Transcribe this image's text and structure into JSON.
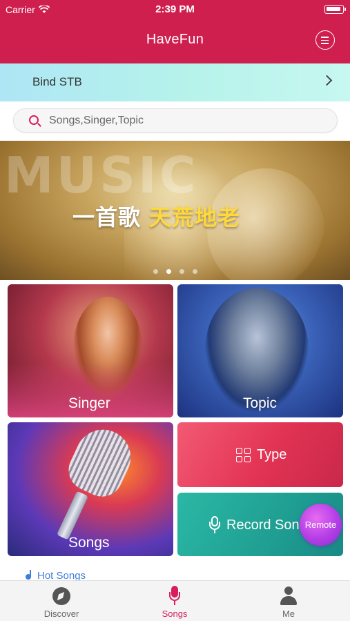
{
  "status_bar": {
    "carrier": "Carrier",
    "time": "2:39 PM"
  },
  "header": {
    "title": "HaveFun",
    "menu_icon": "menu-list-icon",
    "background": "#cf1f4f"
  },
  "bind_bar": {
    "label": "Bind STB",
    "icon": "chevron-right-icon"
  },
  "search": {
    "placeholder": "Songs,Singer,Topic",
    "value": "",
    "icon": "search-icon",
    "accent": "#d81e5b"
  },
  "banner": {
    "background_word": "MUSIC",
    "tagline_white": "一首歌",
    "tagline_yellow": "天荒地老",
    "page_count": 4,
    "active_page": 2
  },
  "tiles": {
    "singer": "Singer",
    "topic": "Topic",
    "songs": "Songs",
    "type": "Type",
    "record": "Record Songs",
    "remote": "Remote"
  },
  "section_peek": {
    "label": "Hot Songs"
  },
  "tabbar": {
    "active_color": "#d81e5b",
    "items": [
      {
        "label": "Discover",
        "icon": "compass-icon",
        "active": false
      },
      {
        "label": "Songs",
        "icon": "microphone-icon",
        "active": true
      },
      {
        "label": "Me",
        "icon": "person-icon",
        "active": false
      }
    ]
  }
}
